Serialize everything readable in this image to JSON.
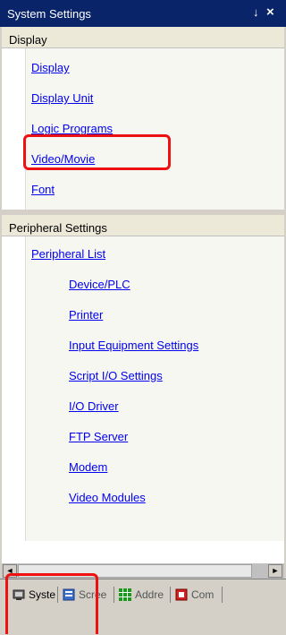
{
  "window": {
    "title": "System Settings",
    "pin_glyph": "↓",
    "close_glyph": "×"
  },
  "display_section": {
    "header": "Display",
    "items": [
      "Display",
      "Display Unit",
      "Logic Programs",
      "Video/Movie",
      "Font"
    ]
  },
  "peripheral_section": {
    "header": "Peripheral Settings",
    "list_label": "Peripheral List",
    "items": [
      "Device/PLC",
      "Printer",
      "Input Equipment Settings",
      "Script I/O Settings",
      "I/O Driver",
      "FTP Server",
      "Modem",
      "Video Modules"
    ]
  },
  "tabs": [
    {
      "label": "Syste",
      "icon": "system-settings-icon"
    },
    {
      "label": "Scree",
      "icon": "screen-list-icon"
    },
    {
      "label": "Addre",
      "icon": "address-grid-icon"
    },
    {
      "label": "Com",
      "icon": "common-settings-icon"
    }
  ],
  "scrollbar": {
    "left_arrow": "◄",
    "right_arrow": "►"
  },
  "colors": {
    "link": "#0000ee",
    "titlebar": "#0a246a",
    "highlight": "#e11111"
  }
}
